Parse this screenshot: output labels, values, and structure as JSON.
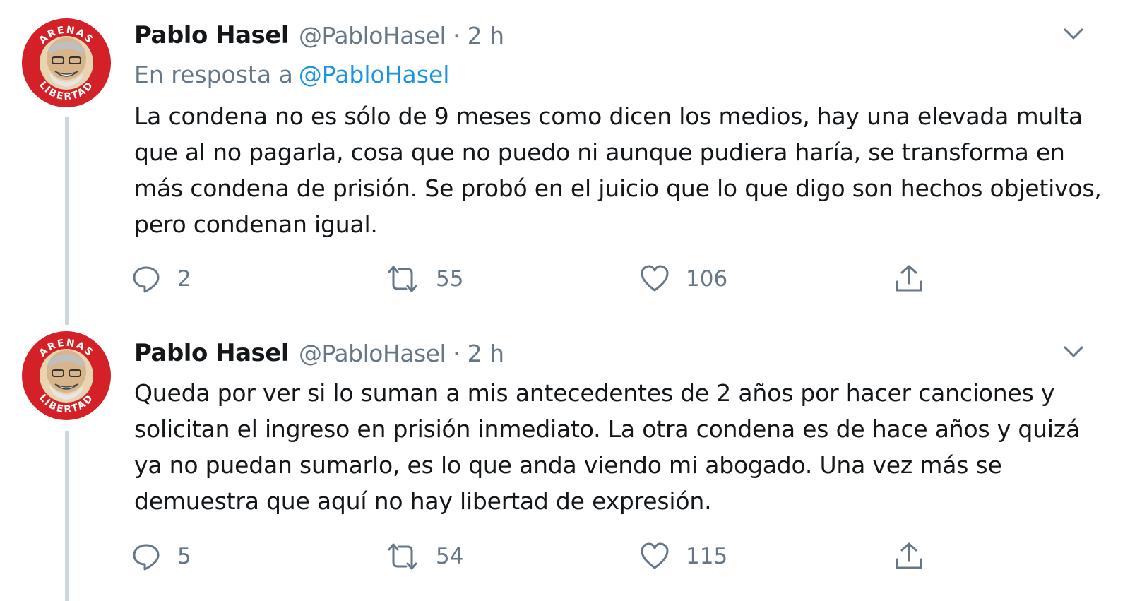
{
  "tweets": [
    {
      "author_name": "Pablo Hasel",
      "author_handle": "@PabloHasel",
      "separator": "·",
      "time": "2 h",
      "reply_prefix": "En resposta a",
      "reply_mention": "@PabloHasel",
      "text": "La condena no es sólo de 9 meses como dicen los medios, hay una elevada multa que al no pagarla, cosa que no puedo ni aunque pudiera haría, se transforma en más condena de prisión. Se probó en el juicio que lo que digo son hechos objetivos, pero condenan igual.",
      "replies": "2",
      "retweets": "55",
      "likes": "106",
      "avatar_text_top": "ARENAS",
      "avatar_text_bottom": "LIBERTAD"
    },
    {
      "author_name": "Pablo Hasel",
      "author_handle": "@PabloHasel",
      "separator": "·",
      "time": "2 h",
      "text": "Queda por ver si lo suman a mis antecedentes de 2 años por hacer canciones y solicitan el ingreso en prisión inmediato. La otra condena es de hace años y quizá ya no puedan sumarlo, es lo que anda viendo mi abogado. Una vez más se demuestra que aquí no hay libertad de expresión.",
      "replies": "5",
      "retweets": "54",
      "likes": "115",
      "avatar_text_top": "ARENAS",
      "avatar_text_bottom": "LIBERTAD"
    }
  ],
  "icons": {
    "reply": "reply-icon",
    "retweet": "retweet-icon",
    "like": "heart-icon",
    "share": "share-icon",
    "caret": "chevron-down-icon"
  },
  "colors": {
    "text": "#14171a",
    "secondary": "#657786",
    "link": "#1b95e0",
    "thread_line": "#ccd6dd",
    "avatar_red": "#d42027"
  }
}
